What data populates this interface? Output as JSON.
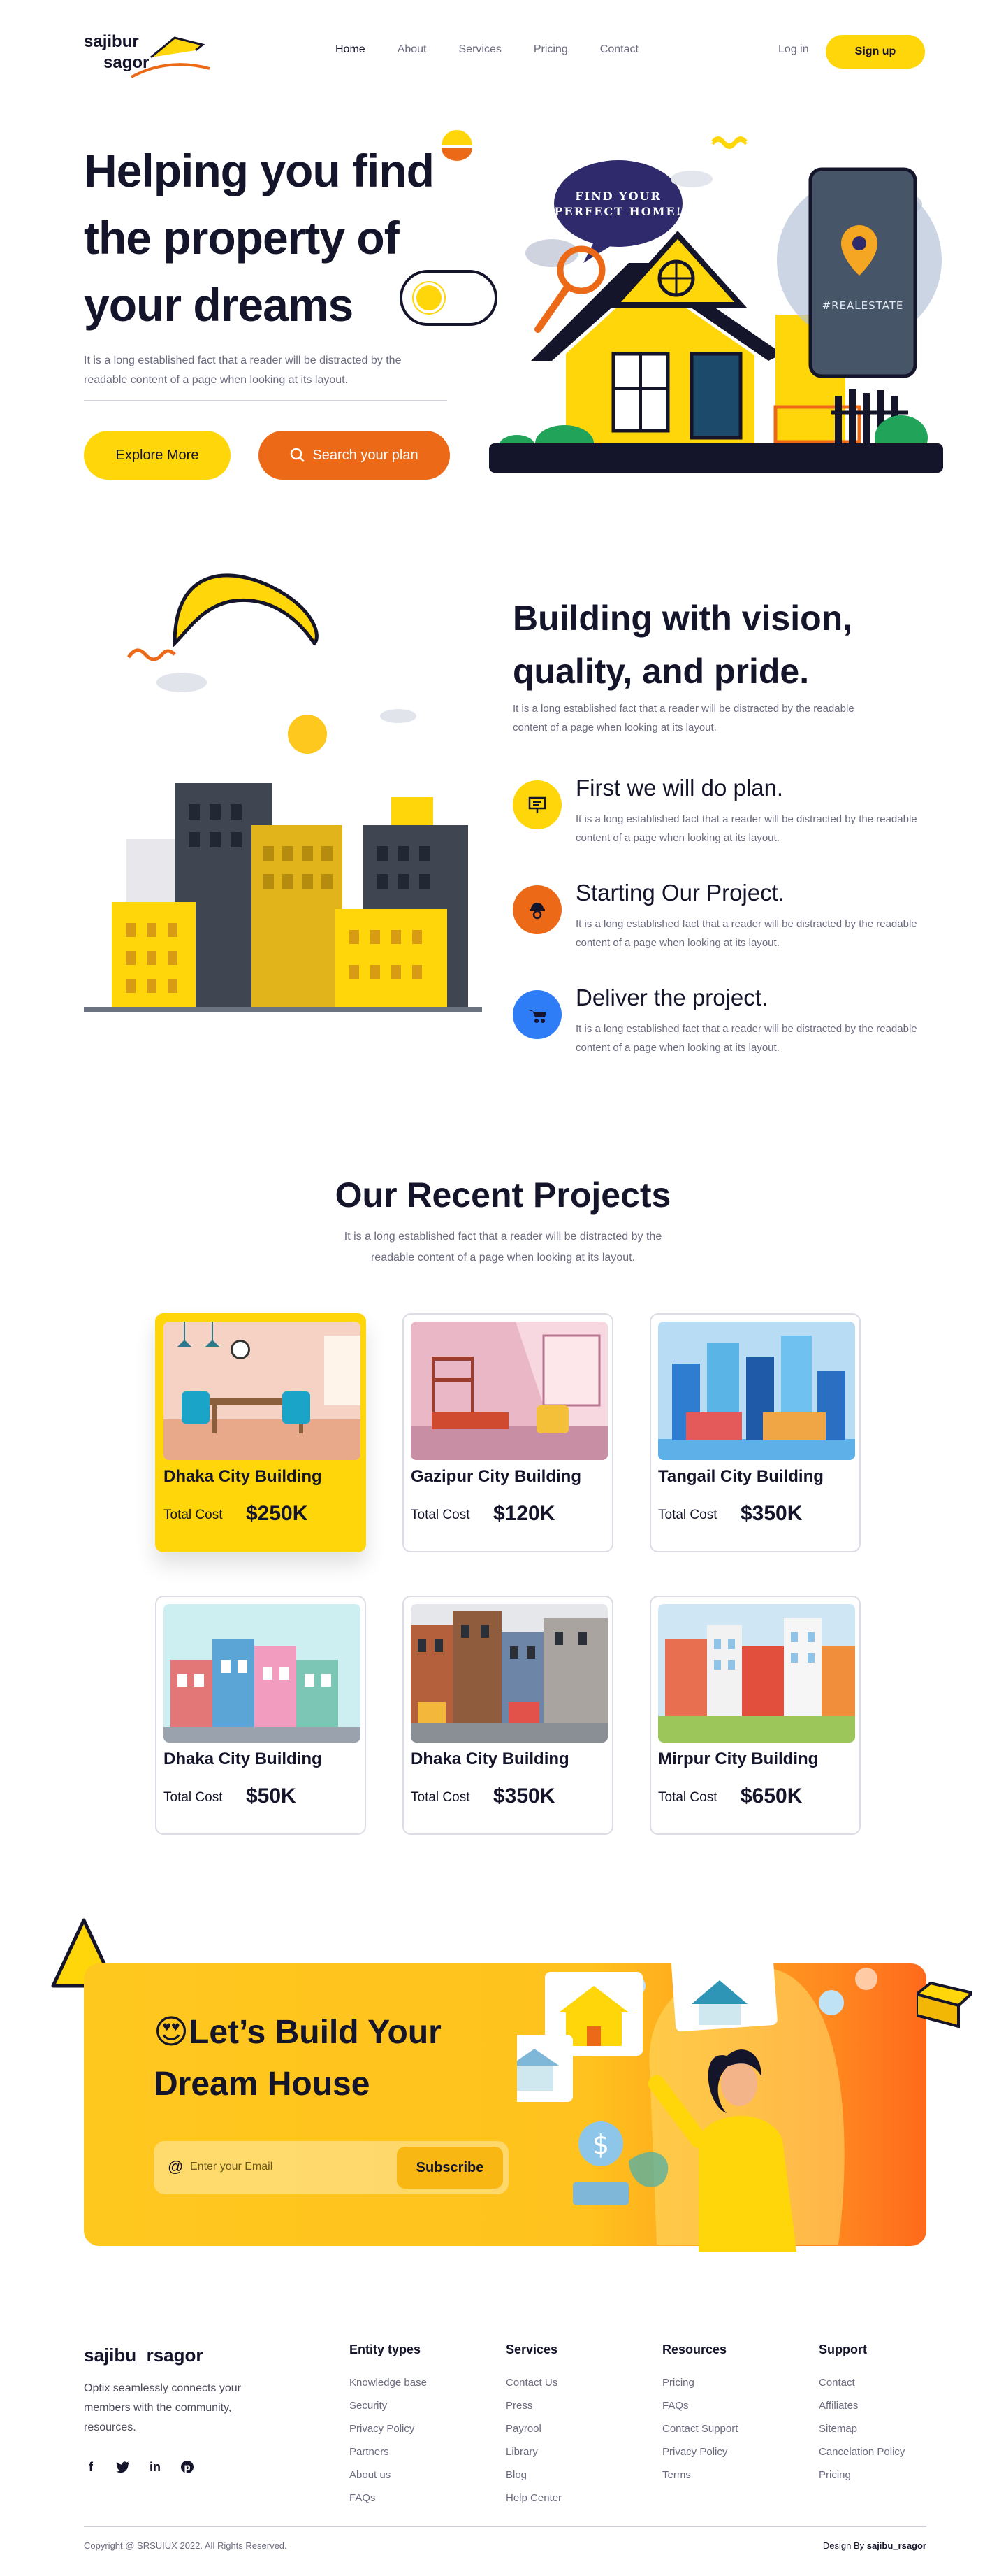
{
  "brand": {
    "line1": "sajibur",
    "line2": "sagor"
  },
  "nav": {
    "links": [
      "Home",
      "About",
      "Services",
      "Pricing",
      "Contact"
    ],
    "login": "Log in",
    "signup": "Sign up"
  },
  "hero": {
    "title_line1": "Helping you find",
    "title_line2": "the property of",
    "title_line3": "your dreams",
    "description": "It is a long established fact that a reader will be distracted by the readable content of a page when looking at its layout.",
    "explore_btn": "Explore More",
    "search_btn": "Search your plan",
    "bubble_line1": "FIND YOUR",
    "bubble_line2": "PERFECT HOME!",
    "phone_tag": "#REALESTATE"
  },
  "building": {
    "title_line1": "Building with vision,",
    "title_line2": "quality, and pride.",
    "description": "It is a long established fact that a reader will be distracted by the readable content of a page when looking at its layout.",
    "features": [
      {
        "title": "First we will do plan.",
        "desc": "It is a long established fact that a reader will be distracted by the readable content of a page when looking at its layout.",
        "icon": "plan-board-icon",
        "color": "#ffd60a"
      },
      {
        "title": "Starting Our Project.",
        "desc": "It is a long established fact that a reader will be distracted by the readable content of a page when looking at its layout.",
        "icon": "worker-icon",
        "color": "#ec6a17"
      },
      {
        "title": "Deliver the project.",
        "desc": "It is a long established fact that a reader will be distracted by the readable content of a page when looking at its layout.",
        "icon": "wheelbarrow-icon",
        "color": "#2f7df6"
      }
    ]
  },
  "projects": {
    "title": "Our Recent Projects",
    "description": "It is a long established fact that a reader will be distracted by the readable content of a page when looking at its layout.",
    "cost_label": "Total Cost",
    "items": [
      {
        "name": "Dhaka City Building",
        "cost": "$250K",
        "highlight": true
      },
      {
        "name": "Gazipur City Building",
        "cost": "$120K",
        "highlight": false
      },
      {
        "name": "Tangail City Building",
        "cost": "$350K",
        "highlight": false
      },
      {
        "name": "Dhaka City Building",
        "cost": "$50K",
        "highlight": false
      },
      {
        "name": "Dhaka City Building",
        "cost": "$350K",
        "highlight": false
      },
      {
        "name": "Mirpur City Building",
        "cost": "$650K",
        "highlight": false
      }
    ]
  },
  "cta": {
    "title_line1": "😍Let’s Build Your",
    "title_line2": "Dream House",
    "email_placeholder": "Enter your Email",
    "at_symbol": "@",
    "subscribe": "Subscribe"
  },
  "footer": {
    "brand": "sajibu_rsagor",
    "description": "Optix seamlessly connects your members with the community, resources.",
    "social": [
      "f",
      "t",
      "in",
      "p"
    ],
    "columns": [
      {
        "heading": "Entity types",
        "items": [
          "Knowledge base",
          "Security",
          "Privacy Policy",
          "Partners",
          "About us",
          "FAQs"
        ]
      },
      {
        "heading": "Services",
        "items": [
          "Contact Us",
          "Press",
          "Payrool",
          "Library",
          "Blog",
          "Help Center"
        ]
      },
      {
        "heading": "Resources",
        "items": [
          "Pricing",
          "FAQs",
          "Contact Support",
          "Privacy Policy",
          "Terms"
        ]
      },
      {
        "heading": "Support",
        "items": [
          "Contact",
          "Affiliates",
          "Sitemap",
          "Cancelation Policy",
          "Pricing"
        ]
      }
    ],
    "copyright": "Copyright @ SRSUIUX 2022. All Rights Reserved.",
    "design_by_prefix": "Design By",
    "design_by_name": "sajibu_rsagor"
  },
  "colors": {
    "yellow": "#ffd60a",
    "orange": "#ec6a17",
    "blue": "#2f7df6",
    "navy": "#14142b"
  }
}
